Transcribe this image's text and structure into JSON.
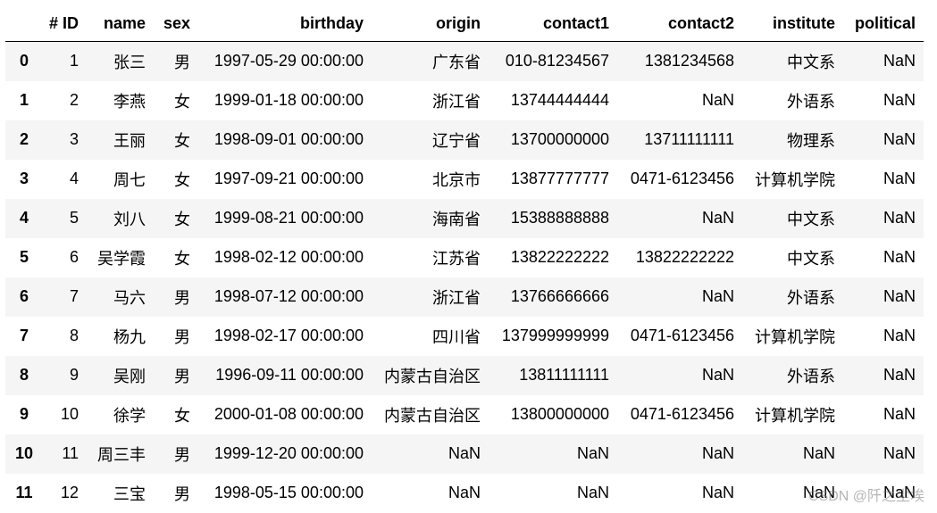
{
  "columns": [
    "",
    "# ID",
    "name",
    "sex",
    "birthday",
    "origin",
    "contact1",
    "contact2",
    "institute",
    "political"
  ],
  "rows": [
    [
      "0",
      "1",
      "张三",
      "男",
      "1997-05-29 00:00:00",
      "广东省",
      "010-81234567",
      "1381234568",
      "中文系",
      "NaN"
    ],
    [
      "1",
      "2",
      "李燕",
      "女",
      "1999-01-18 00:00:00",
      "浙江省",
      "13744444444",
      "NaN",
      "外语系",
      "NaN"
    ],
    [
      "2",
      "3",
      "王丽",
      "女",
      "1998-09-01 00:00:00",
      "辽宁省",
      "13700000000",
      "13711111111",
      "物理系",
      "NaN"
    ],
    [
      "3",
      "4",
      "周七",
      "女",
      "1997-09-21 00:00:00",
      "北京市",
      "13877777777",
      "0471-6123456",
      "计算机学院",
      "NaN"
    ],
    [
      "4",
      "5",
      "刘八",
      "女",
      "1999-08-21 00:00:00",
      "海南省",
      "15388888888",
      "NaN",
      "中文系",
      "NaN"
    ],
    [
      "5",
      "6",
      "吴学霞",
      "女",
      "1998-02-12 00:00:00",
      "江苏省",
      "13822222222",
      "13822222222",
      "中文系",
      "NaN"
    ],
    [
      "6",
      "7",
      "马六",
      "男",
      "1998-07-12 00:00:00",
      "浙江省",
      "13766666666",
      "NaN",
      "外语系",
      "NaN"
    ],
    [
      "7",
      "8",
      "杨九",
      "男",
      "1998-02-17 00:00:00",
      "四川省",
      "137999999999",
      "0471-6123456",
      "计算机学院",
      "NaN"
    ],
    [
      "8",
      "9",
      "吴刚",
      "男",
      "1996-09-11 00:00:00",
      "内蒙古自治区",
      "13811111111",
      "NaN",
      "外语系",
      "NaN"
    ],
    [
      "9",
      "10",
      "徐学",
      "女",
      "2000-01-08 00:00:00",
      "内蒙古自治区",
      "13800000000",
      "0471-6123456",
      "计算机学院",
      "NaN"
    ],
    [
      "10",
      "11",
      "周三丰",
      "男",
      "1999-12-20 00:00:00",
      "NaN",
      "NaN",
      "NaN",
      "NaN",
      "NaN"
    ],
    [
      "11",
      "12",
      "三宝",
      "男",
      "1998-05-15 00:00:00",
      "NaN",
      "NaN",
      "NaN",
      "NaN",
      "NaN"
    ]
  ],
  "watermark": "CSDN @阡之尘埃"
}
